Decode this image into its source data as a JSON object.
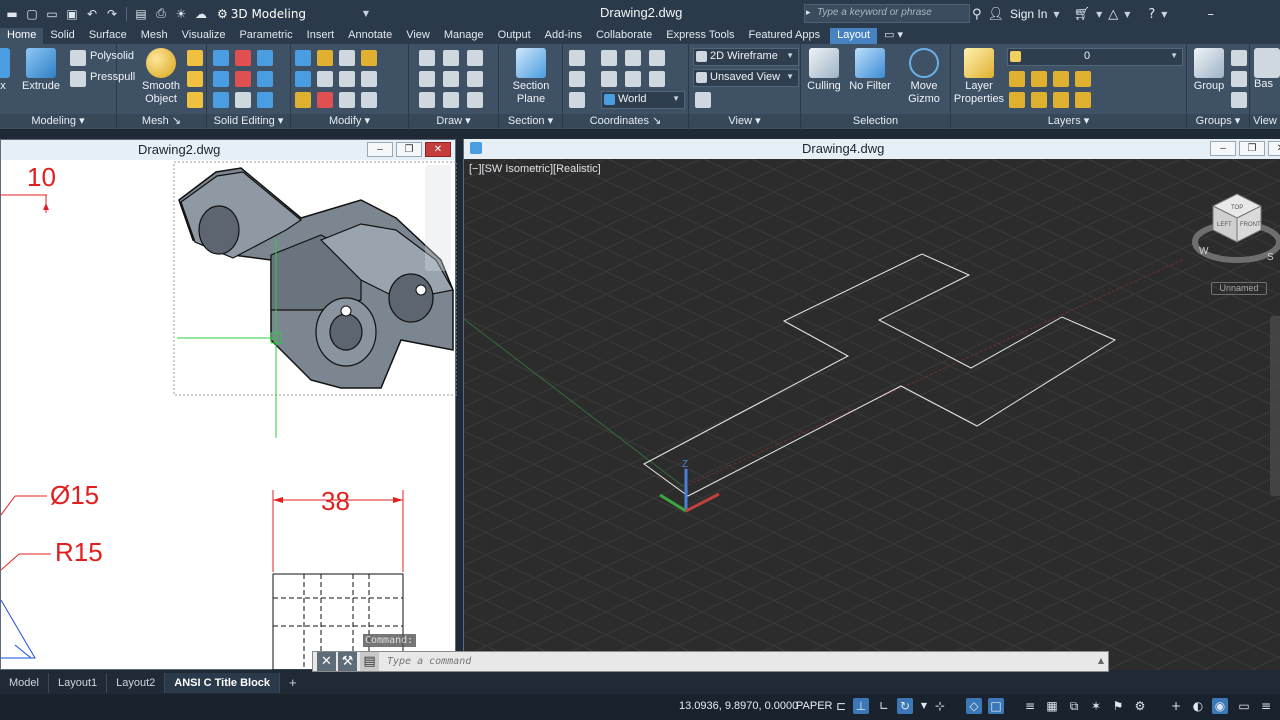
{
  "titlebar": {
    "workspace": "3D Modeling",
    "document_title": "Drawing2.dwg",
    "search_placeholder": "Type a keyword or phrase",
    "sign_in": "Sign In"
  },
  "ribbon_tabs": [
    "Home",
    "Solid",
    "Surface",
    "Mesh",
    "Visualize",
    "Parametric",
    "Insert",
    "Annotate",
    "View",
    "Manage",
    "Output",
    "Add-ins",
    "Collaborate",
    "Express Tools",
    "Featured Apps",
    "Layout"
  ],
  "ribbon": {
    "modeling": {
      "extrude": "Extrude",
      "polysolid": "Polysolid",
      "presspull": "Presspull",
      "label": "Modeling"
    },
    "mesh": {
      "smooth_object": "Smooth Object",
      "label": "Mesh"
    },
    "solid_editing": {
      "label": "Solid Editing"
    },
    "modify": {
      "label": "Modify"
    },
    "draw": {
      "label": "Draw"
    },
    "section": {
      "section_plane": "Section Plane",
      "label": "Section"
    },
    "coordinates": {
      "world": "World",
      "label": "Coordinates"
    },
    "view": {
      "visual_style": "2D Wireframe",
      "named_view": "Unsaved View",
      "label": "View"
    },
    "selection": {
      "culling": "Culling",
      "no_filter": "No Filter",
      "move_gizmo": "Move Gizmo",
      "label": "Selection"
    },
    "layers": {
      "layer_properties": "Layer Properties",
      "current_layer": "0",
      "label": "Layers"
    },
    "groups": {
      "group": "Group",
      "label": "Groups"
    },
    "view2": {
      "label": "View",
      "base": "Bas"
    }
  },
  "left_window": {
    "title": "Drawing2.dwg",
    "dim_top": "10",
    "dim_diameter": "Ø15",
    "dim_radius": "R15",
    "dim_width": "38"
  },
  "right_window": {
    "title": "Drawing4.dwg",
    "viewport_controls": "[−][SW Isometric][Realistic]",
    "viewcube_faces": {
      "top": "TOP",
      "left": "LEFT",
      "front": "FRONT"
    },
    "compass": {
      "w": "W",
      "s": "S"
    },
    "ucs_name": "Unnamed"
  },
  "command": {
    "history_label": "Command:",
    "placeholder": "Type a command"
  },
  "layout_tabs": [
    "Model",
    "Layout1",
    "Layout2",
    "ANSI C Title Block"
  ],
  "status": {
    "coordinates": "13.0936, 9.8970, 0.0000",
    "space": "PAPER"
  },
  "colors": {
    "ribbon_bg": "#3f5165",
    "titlebar_bg": "#2b3a4a",
    "layout_tab_accent": "#4783c2",
    "dimension_red": "#e02020",
    "viewport_bg": "#2c2c2c"
  }
}
